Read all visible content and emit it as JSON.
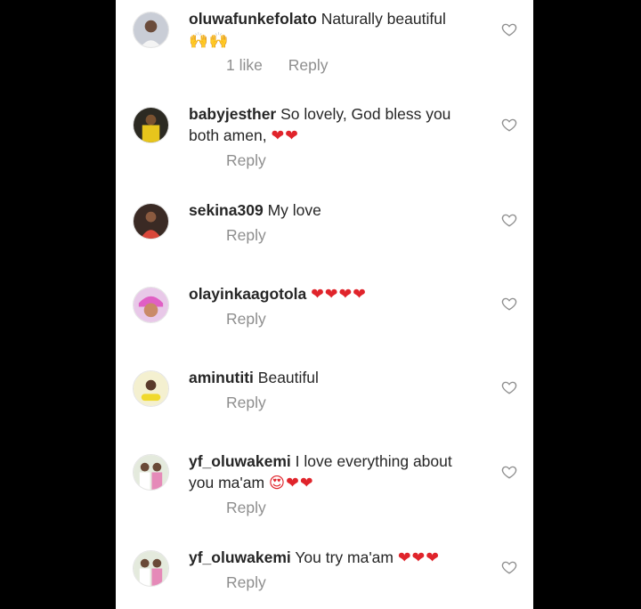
{
  "comments": [
    {
      "user": "oluwafunkefolato",
      "text": "Naturally beautiful",
      "emoji": "🙌🙌",
      "likes": "1 like",
      "reply": "Reply"
    },
    {
      "user": "babyjesther",
      "text": "So lovely, God bless you both amen,",
      "emoji": "❤❤",
      "reply": "Reply"
    },
    {
      "user": "sekina309",
      "text": "My love",
      "emoji": "",
      "reply": "Reply"
    },
    {
      "user": "olayinkaagotola",
      "text": "",
      "emoji": "❤❤❤❤",
      "reply": "Reply"
    },
    {
      "user": "aminutiti",
      "text": "Beautiful",
      "emoji": "",
      "reply": "Reply"
    },
    {
      "user": "yf_oluwakemi",
      "text": "I love everything about you ma'am",
      "emoji": "😍❤❤",
      "reply": "Reply"
    },
    {
      "user": "yf_oluwakemi",
      "text": "You try ma'am",
      "emoji": "❤❤❤",
      "reply": "Reply"
    }
  ],
  "icons": {
    "like": "heart-outline-icon"
  },
  "colors": {
    "username": "#262626",
    "meta": "#8e8e8e",
    "heart": "#8e8e8e",
    "emoji_heart": "#e0242b",
    "background": "#ffffff",
    "frame": "#000000"
  }
}
